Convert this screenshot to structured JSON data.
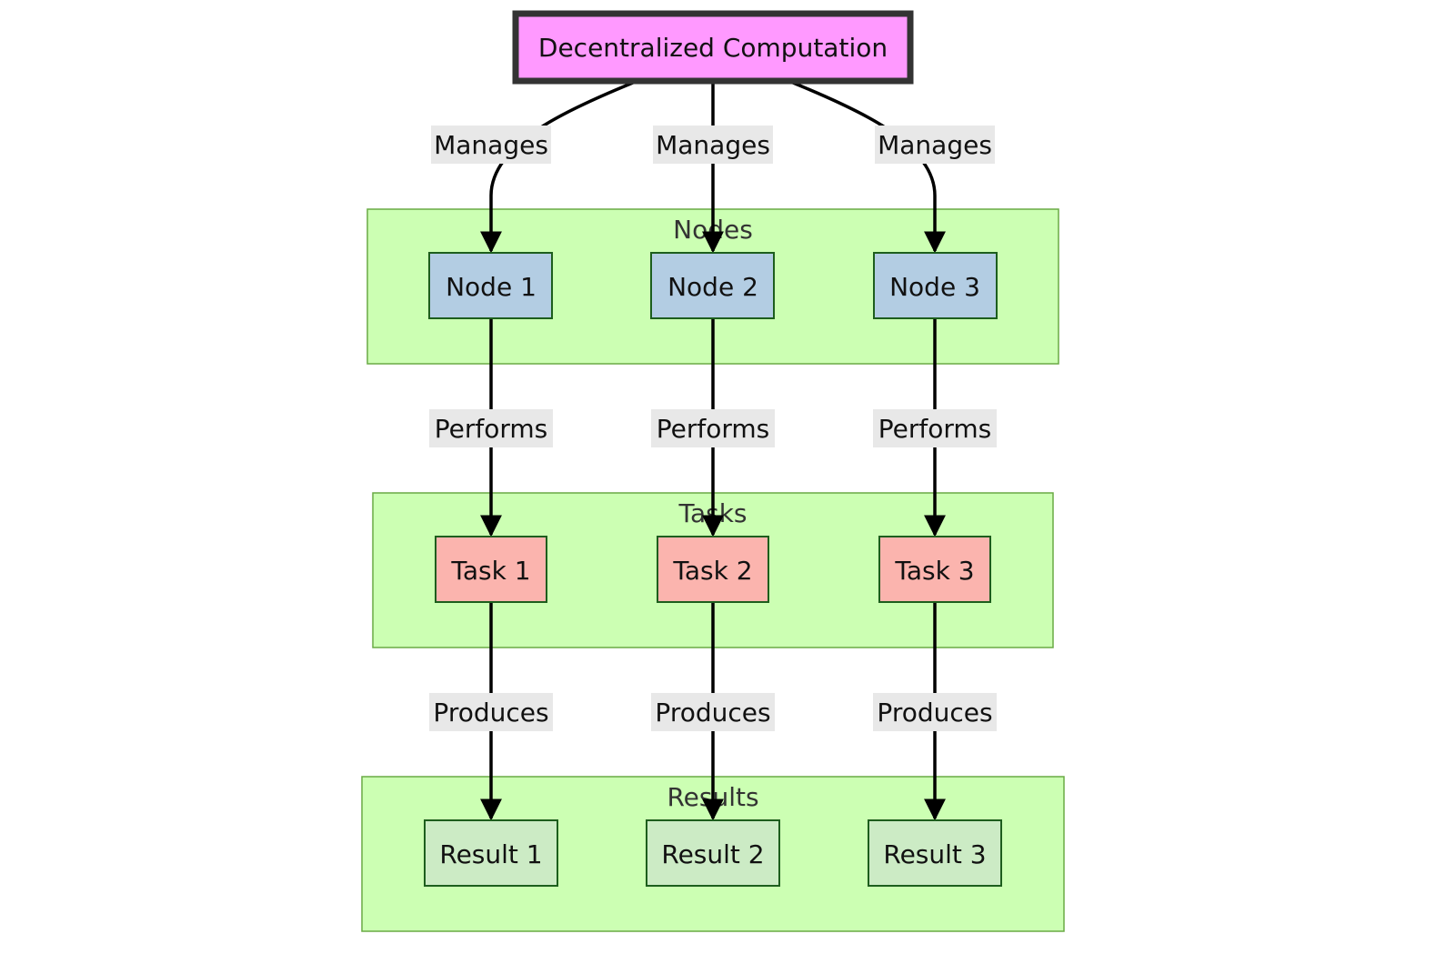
{
  "diagram": {
    "root": {
      "label": "Decentralized Computation",
      "fill": "#ff99ff",
      "stroke": "#333333"
    },
    "groups": [
      {
        "id": "nodes",
        "title": "Nodes",
        "fill": "#ccffb3",
        "stroke": "#6aaa45"
      },
      {
        "id": "tasks",
        "title": "Tasks",
        "fill": "#ccffb3",
        "stroke": "#6aaa45"
      },
      {
        "id": "results",
        "title": "Results",
        "fill": "#ccffb3",
        "stroke": "#6aaa45"
      }
    ],
    "nodes": [
      {
        "label": "Node 1",
        "fill": "#b3cde3"
      },
      {
        "label": "Node 2",
        "fill": "#b3cde3"
      },
      {
        "label": "Node 3",
        "fill": "#b3cde3"
      }
    ],
    "tasks": [
      {
        "label": "Task 1",
        "fill": "#fbb4ae"
      },
      {
        "label": "Task 2",
        "fill": "#fbb4ae"
      },
      {
        "label": "Task 3",
        "fill": "#fbb4ae"
      }
    ],
    "results": [
      {
        "label": "Result 1",
        "fill": "#ccebc5"
      },
      {
        "label": "Result 2",
        "fill": "#ccebc5"
      },
      {
        "label": "Result 3",
        "fill": "#ccebc5"
      }
    ],
    "edges": {
      "manages": [
        "Manages",
        "Manages",
        "Manages"
      ],
      "performs": [
        "Performs",
        "Performs",
        "Performs"
      ],
      "produces": [
        "Produces",
        "Produces",
        "Produces"
      ]
    },
    "node_stroke": "#1d5e1d",
    "edge_label_bg": "#e8e8e8"
  }
}
